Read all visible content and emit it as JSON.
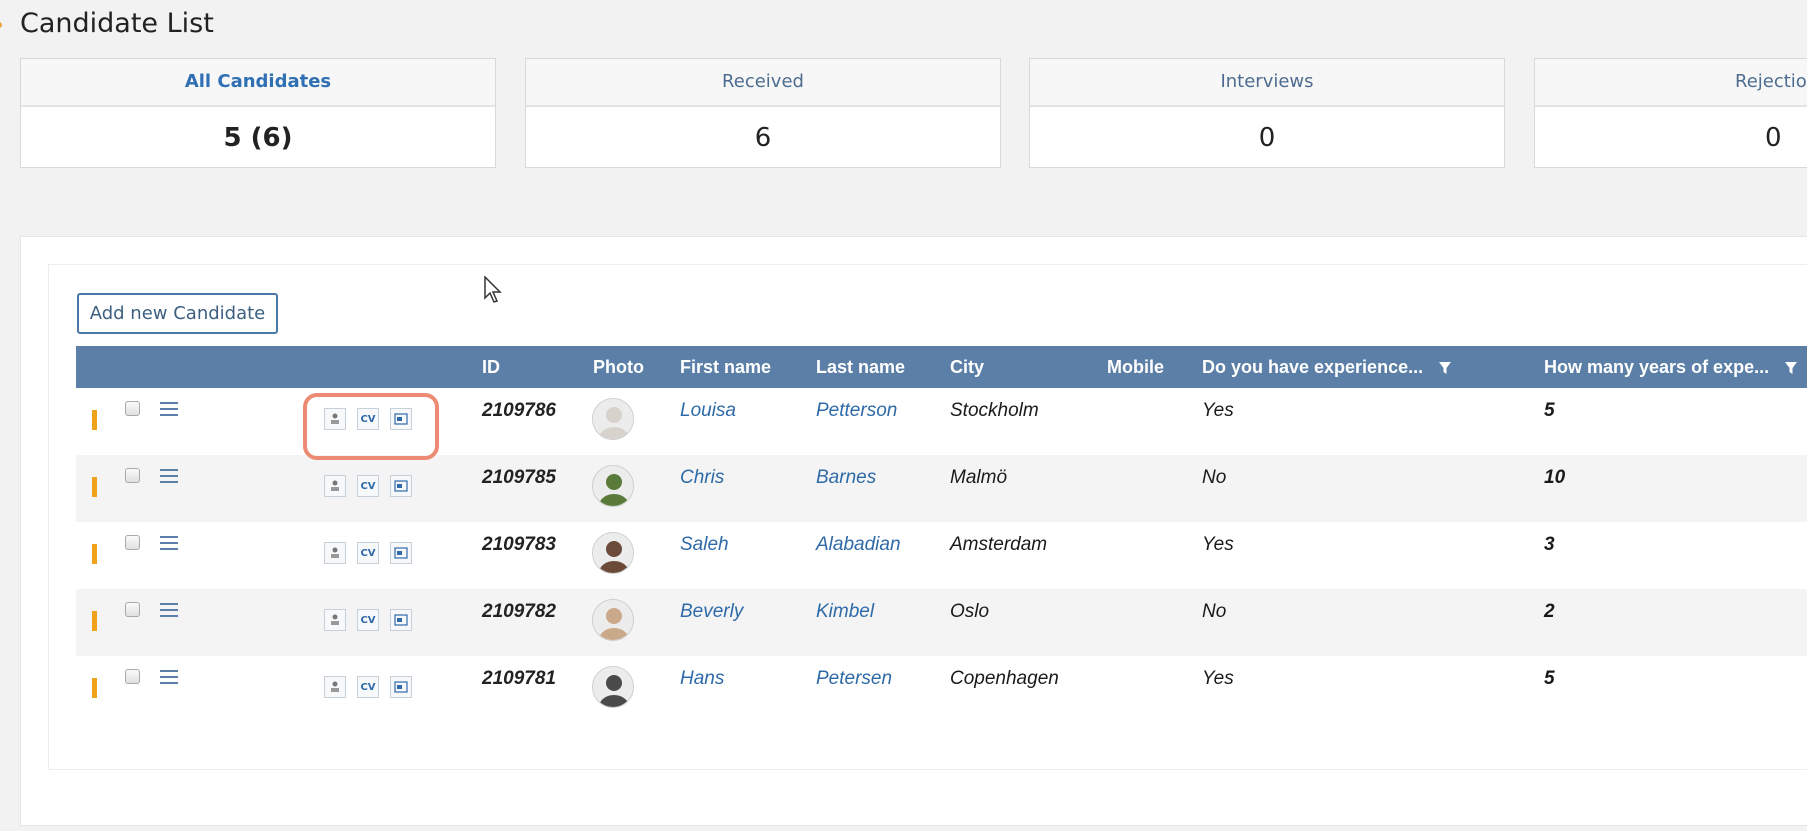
{
  "page": {
    "title": "Candidate List"
  },
  "stats": [
    {
      "label": "All Candidates",
      "value": "5 (6)"
    },
    {
      "label": "Received",
      "value": "6"
    },
    {
      "label": "Interviews",
      "value": "0"
    },
    {
      "label": "Rejection",
      "value": "0"
    }
  ],
  "toolbar": {
    "add_label": "Add new Candidate"
  },
  "grid": {
    "headers": {
      "id": "ID",
      "photo": "Photo",
      "first_name": "First name",
      "last_name": "Last name",
      "city": "City",
      "mobile": "Mobile",
      "experience": "Do you have experience...",
      "years": "How many years of expe..."
    },
    "doc_icons": {
      "profile": "profile-doc-icon",
      "cv": "CV",
      "letter": "letter-doc-icon"
    },
    "rows": [
      {
        "id": "2109786",
        "first_name": "Louisa",
        "last_name": "Petterson",
        "city": "Stockholm",
        "experience": "Yes",
        "years": "5",
        "avatar_color": "#d8d2cc"
      },
      {
        "id": "2109785",
        "first_name": "Chris",
        "last_name": "Barnes",
        "city": "Malmö",
        "experience": "No",
        "years": "10",
        "avatar_color": "#5a7a3a"
      },
      {
        "id": "2109783",
        "first_name": "Saleh",
        "last_name": "Alabadian",
        "city": "Amsterdam",
        "experience": "Yes",
        "years": "3",
        "avatar_color": "#6b4a3a"
      },
      {
        "id": "2109782",
        "first_name": "Beverly",
        "last_name": "Kimbel",
        "city": "Oslo",
        "experience": "No",
        "years": "2",
        "avatar_color": "#caa98a"
      },
      {
        "id": "2109781",
        "first_name": "Hans",
        "last_name": "Petersen",
        "city": "Copenhagen",
        "experience": "Yes",
        "years": "5",
        "avatar_color": "#4a4a4a"
      }
    ]
  },
  "colors": {
    "header_bg": "#5b7fa6",
    "link": "#2e6aa8",
    "accent_orange": "#f0a21a",
    "highlight": "#ec8a73"
  }
}
